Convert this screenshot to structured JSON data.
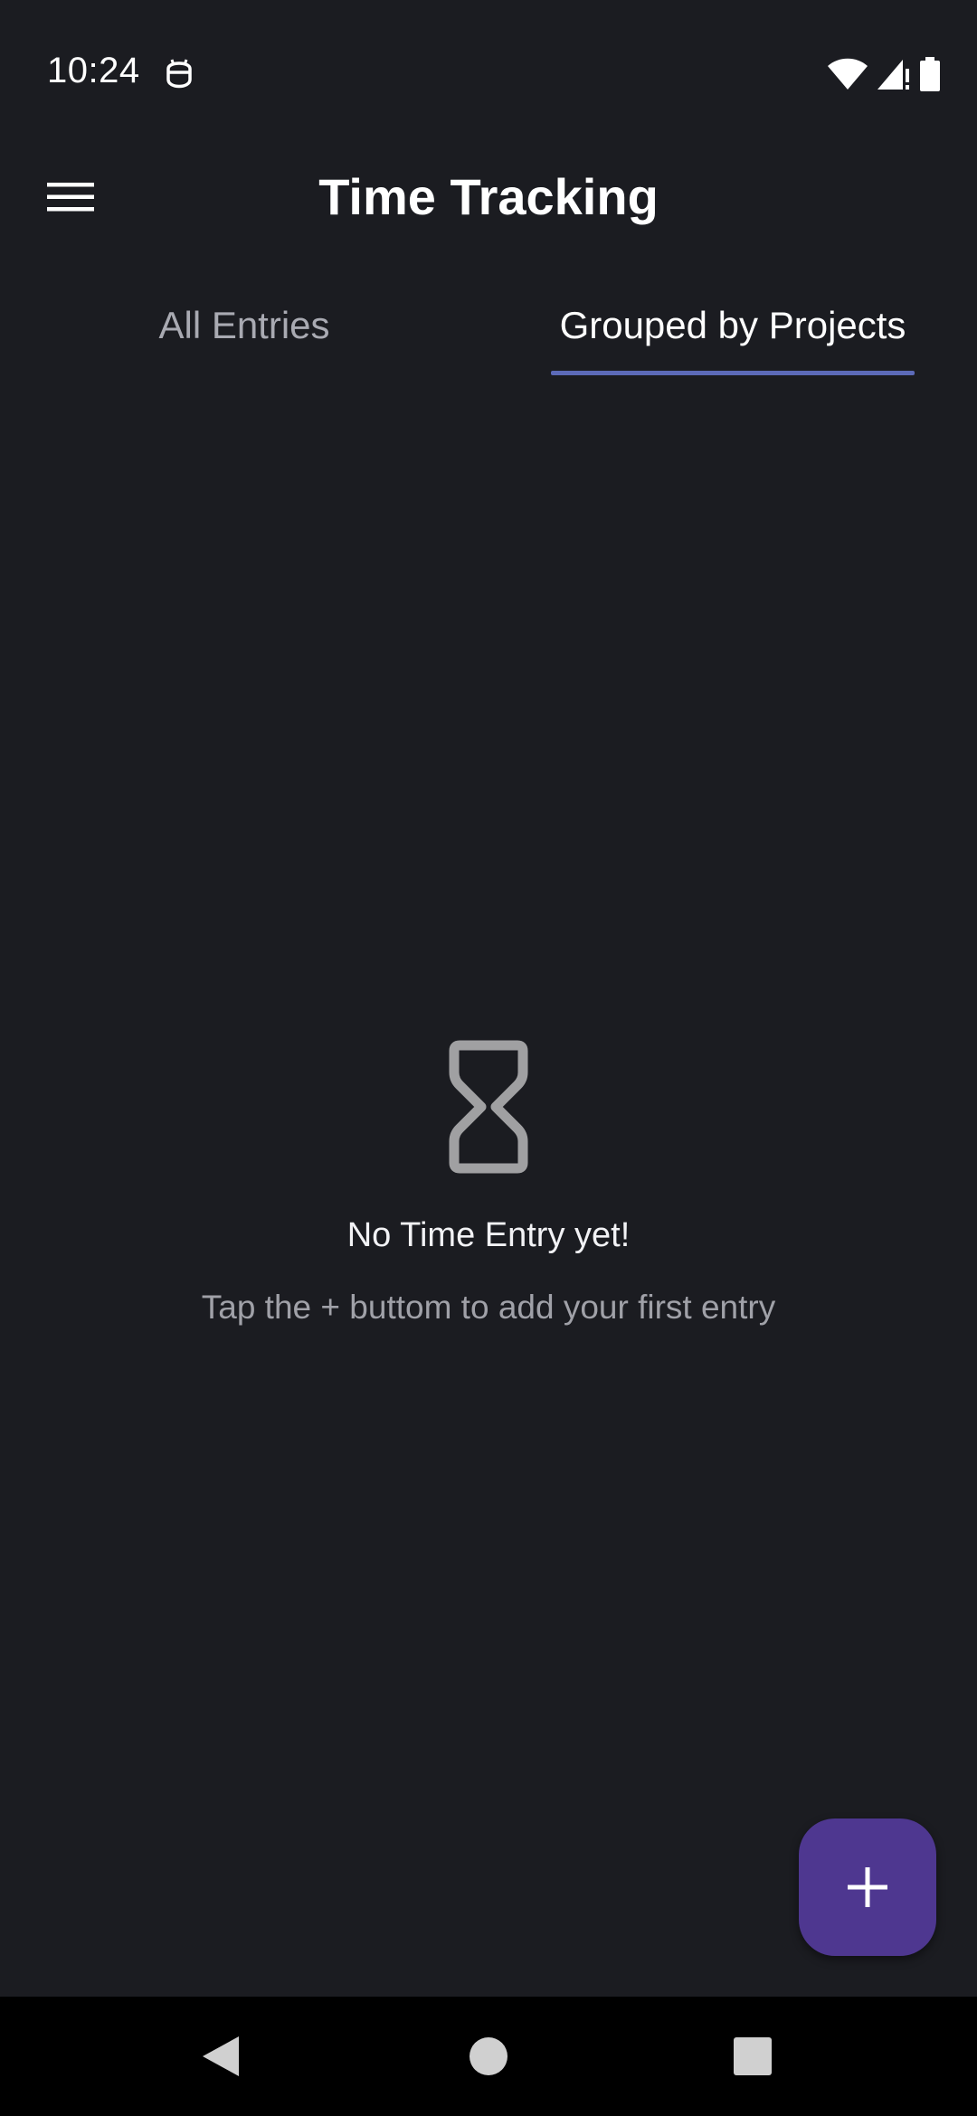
{
  "status_bar": {
    "time": "10:24",
    "icons": [
      "app-notification-icon",
      "wifi-icon",
      "signal-icon",
      "battery-icon"
    ]
  },
  "app_bar": {
    "title": "Time Tracking",
    "menu_icon": "hamburger-menu-icon"
  },
  "tabs": [
    {
      "label": "All Entries",
      "selected": false
    },
    {
      "label": "Grouped by Projects",
      "selected": true
    }
  ],
  "empty_state": {
    "icon": "hourglass-icon",
    "title": "No Time Entry yet!",
    "subtitle": "Tap the + buttom to add your first entry"
  },
  "fab": {
    "icon": "plus-icon"
  },
  "nav_bar": {
    "buttons": [
      "back-icon",
      "home-icon",
      "recents-icon"
    ]
  },
  "colors": {
    "background": "#1b1c21",
    "tab_indicator": "#5c6ab8",
    "fab": "#4e3790",
    "nav_bar": "#000000"
  }
}
